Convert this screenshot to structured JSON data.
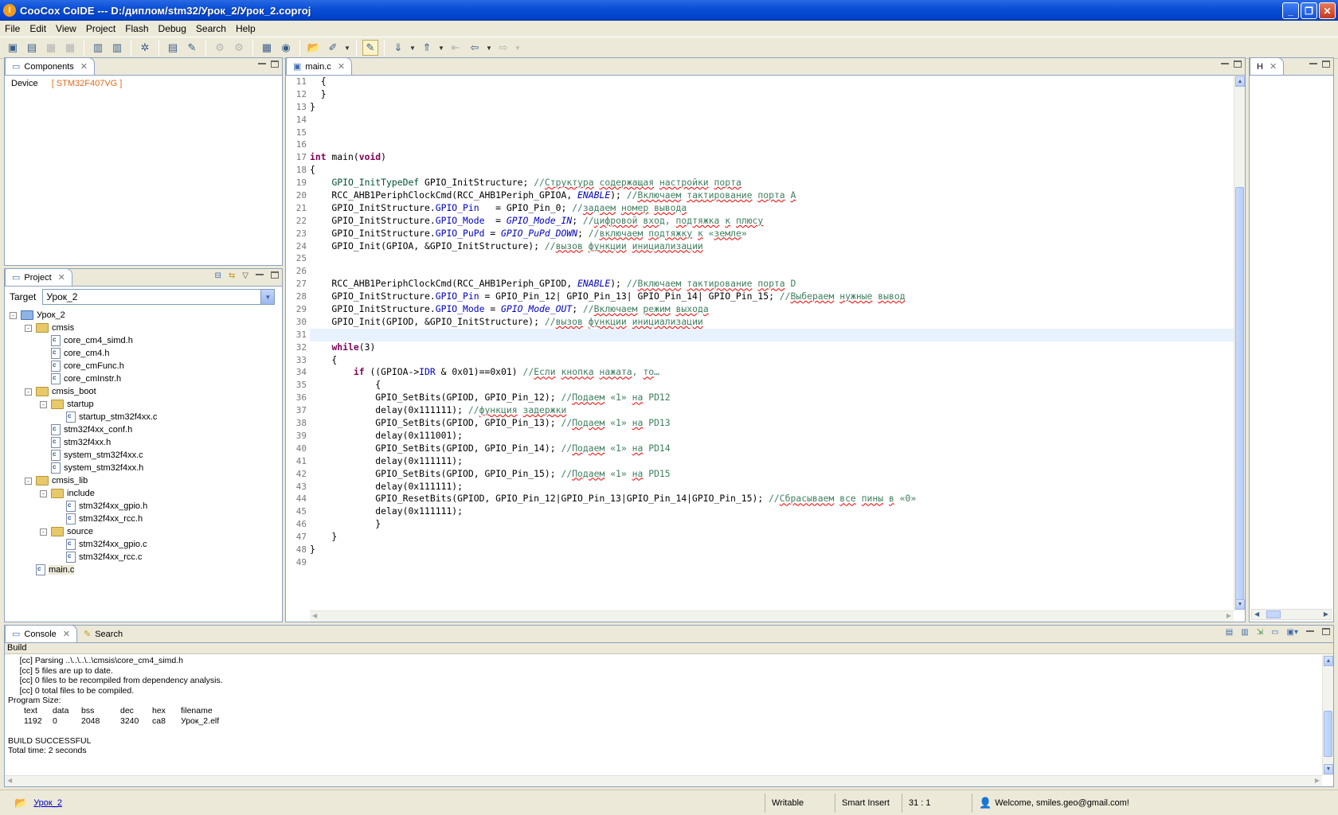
{
  "window": {
    "title": "CooCox CoIDE --- D:/диплом/stm32/Урок_2/Урок_2.coproj"
  },
  "menu": [
    "File",
    "Edit",
    "View",
    "Project",
    "Flash",
    "Debug",
    "Search",
    "Help"
  ],
  "components_panel": {
    "tab_label": "Components",
    "device_label": "Device",
    "device_value": "[ STM32F407VG ]"
  },
  "project_panel": {
    "tab_label": "Project",
    "target_label": "Target",
    "target_value": "Урок_2",
    "tree": [
      {
        "label": "Урок_2",
        "depth": 0,
        "kind": "project",
        "toggle": "-"
      },
      {
        "label": "cmsis",
        "depth": 1,
        "kind": "folder",
        "toggle": "-"
      },
      {
        "label": "core_cm4_simd.h",
        "depth": 2,
        "kind": "file"
      },
      {
        "label": "core_cm4.h",
        "depth": 2,
        "kind": "file"
      },
      {
        "label": "core_cmFunc.h",
        "depth": 2,
        "kind": "file"
      },
      {
        "label": "core_cmInstr.h",
        "depth": 2,
        "kind": "file"
      },
      {
        "label": "cmsis_boot",
        "depth": 1,
        "kind": "folder",
        "toggle": "-"
      },
      {
        "label": "startup",
        "depth": 2,
        "kind": "folder",
        "toggle": "-"
      },
      {
        "label": "startup_stm32f4xx.c",
        "depth": 3,
        "kind": "file"
      },
      {
        "label": "stm32f4xx_conf.h",
        "depth": 2,
        "kind": "file"
      },
      {
        "label": "stm32f4xx.h",
        "depth": 2,
        "kind": "file"
      },
      {
        "label": "system_stm32f4xx.c",
        "depth": 2,
        "kind": "file"
      },
      {
        "label": "system_stm32f4xx.h",
        "depth": 2,
        "kind": "file"
      },
      {
        "label": "cmsis_lib",
        "depth": 1,
        "kind": "folder",
        "toggle": "-"
      },
      {
        "label": "include",
        "depth": 2,
        "kind": "folder",
        "toggle": "-"
      },
      {
        "label": "stm32f4xx_gpio.h",
        "depth": 3,
        "kind": "file"
      },
      {
        "label": "stm32f4xx_rcc.h",
        "depth": 3,
        "kind": "file"
      },
      {
        "label": "source",
        "depth": 2,
        "kind": "folder",
        "toggle": "-"
      },
      {
        "label": "stm32f4xx_gpio.c",
        "depth": 3,
        "kind": "file"
      },
      {
        "label": "stm32f4xx_rcc.c",
        "depth": 3,
        "kind": "file"
      },
      {
        "label": "main.c",
        "depth": 1,
        "kind": "file"
      }
    ]
  },
  "editor": {
    "tab_label": "main.c",
    "current_line": 31,
    "lines": [
      {
        "n": "11",
        "t": "  {"
      },
      {
        "n": "12",
        "t": "  }"
      },
      {
        "n": "13",
        "t": "}"
      },
      {
        "n": "14",
        "t": ""
      },
      {
        "n": "15",
        "t": ""
      },
      {
        "n": "16",
        "t": ""
      },
      {
        "n": "17",
        "t": "int main(void)"
      },
      {
        "n": "18",
        "t": "{"
      },
      {
        "n": "19",
        "t": "    GPIO_InitTypeDef GPIO_InitStructure; //Структура содержащая настройки порта"
      },
      {
        "n": "20",
        "t": "    RCC_AHB1PeriphClockCmd(RCC_AHB1Periph_GPIOA, ENABLE); //Включаем тактирование порта А"
      },
      {
        "n": "21",
        "t": "    GPIO_InitStructure.GPIO_Pin   = GPIO_Pin_0; //задаем номер вывода"
      },
      {
        "n": "22",
        "t": "    GPIO_InitStructure.GPIO_Mode  = GPIO_Mode_IN; //цифровой вход, подтяжка к плюсу"
      },
      {
        "n": "23",
        "t": "    GPIO_InitStructure.GPIO_PuPd = GPIO_PuPd_DOWN; //включаем подтяжку к «земле»"
      },
      {
        "n": "24",
        "t": "    GPIO_Init(GPIOA, &GPIO_InitStructure); //вызов функции инициализации"
      },
      {
        "n": "25",
        "t": ""
      },
      {
        "n": "26",
        "t": ""
      },
      {
        "n": "27",
        "t": "    RCC_AHB1PeriphClockCmd(RCC_AHB1Periph_GPIOD, ENABLE); //Включаем тактирование порта D"
      },
      {
        "n": "28",
        "t": "    GPIO_InitStructure.GPIO_Pin = GPIO_Pin_12| GPIO_Pin_13| GPIO_Pin_14| GPIO_Pin_15; //Выбераем нужные вывод"
      },
      {
        "n": "29",
        "t": "    GPIO_InitStructure.GPIO_Mode = GPIO_Mode_OUT; //Включаем режим выхода"
      },
      {
        "n": "30",
        "t": "    GPIO_Init(GPIOD, &GPIO_InitStructure); //вызов функции инициализации"
      },
      {
        "n": "31",
        "t": ""
      },
      {
        "n": "32",
        "t": "    while(3)"
      },
      {
        "n": "33",
        "t": "    {"
      },
      {
        "n": "34",
        "t": "        if ((GPIOA->IDR & 0x01)==0x01) //Если кнопка нажата, то…"
      },
      {
        "n": "35",
        "t": "            {"
      },
      {
        "n": "36",
        "t": "            GPIO_SetBits(GPIOD, GPIO_Pin_12); //Подаем «1» на PD12"
      },
      {
        "n": "37",
        "t": "            delay(0x111111); //функция задержки"
      },
      {
        "n": "38",
        "t": "            GPIO_SetBits(GPIOD, GPIO_Pin_13); //Подаем «1» на PD13"
      },
      {
        "n": "39",
        "t": "            delay(0x111001);"
      },
      {
        "n": "40",
        "t": "            GPIO_SetBits(GPIOD, GPIO_Pin_14); //Подаем «1» на PD14"
      },
      {
        "n": "41",
        "t": "            delay(0x111111);"
      },
      {
        "n": "42",
        "t": "            GPIO_SetBits(GPIOD, GPIO_Pin_15); //Подаем «1» на PD15"
      },
      {
        "n": "43",
        "t": "            delay(0x111111);"
      },
      {
        "n": "44",
        "t": "            GPIO_ResetBits(GPIOD, GPIO_Pin_12|GPIO_Pin_13|GPIO_Pin_14|GPIO_Pin_15); //Сбрасываем все пины в «0»"
      },
      {
        "n": "45",
        "t": "            delay(0x111111);"
      },
      {
        "n": "46",
        "t": "            }"
      },
      {
        "n": "47",
        "t": "    }"
      },
      {
        "n": "48",
        "t": "}"
      },
      {
        "n": "49",
        "t": ""
      }
    ]
  },
  "right_panel": {
    "tab_label": "H"
  },
  "console": {
    "tabs": [
      "Console",
      "Search"
    ],
    "subheader": "Build",
    "lines": [
      "     [cc] Parsing ..\\..\\..\\..\\cmsis\\core_cm4_simd.h",
      "     [cc] 5 files are up to date.",
      "     [cc] 0 files to be recompiled from dependency analysis.",
      "     [cc] 0 total files to be compiled.",
      "Program Size:"
    ],
    "size_header": [
      "text",
      "data",
      "bss",
      "dec",
      "hex",
      "filename"
    ],
    "size_values": [
      "1192",
      "0",
      "2048",
      "3240",
      "ca8",
      "Урок_2.elf"
    ],
    "footer_lines": [
      "",
      "BUILD SUCCESSFUL",
      "Total time: 2 seconds"
    ]
  },
  "statusbar": {
    "project_link": "Урок_2",
    "mode": "Writable",
    "insert": "Smart Insert",
    "position": "31 : 1",
    "welcome": "Welcome, smiles.geo@gmail.com!"
  },
  "colors": {
    "keyword": "#7f0055",
    "comment": "#3f7f5f",
    "field": "#0000c0",
    "device": "#e06c1a"
  }
}
